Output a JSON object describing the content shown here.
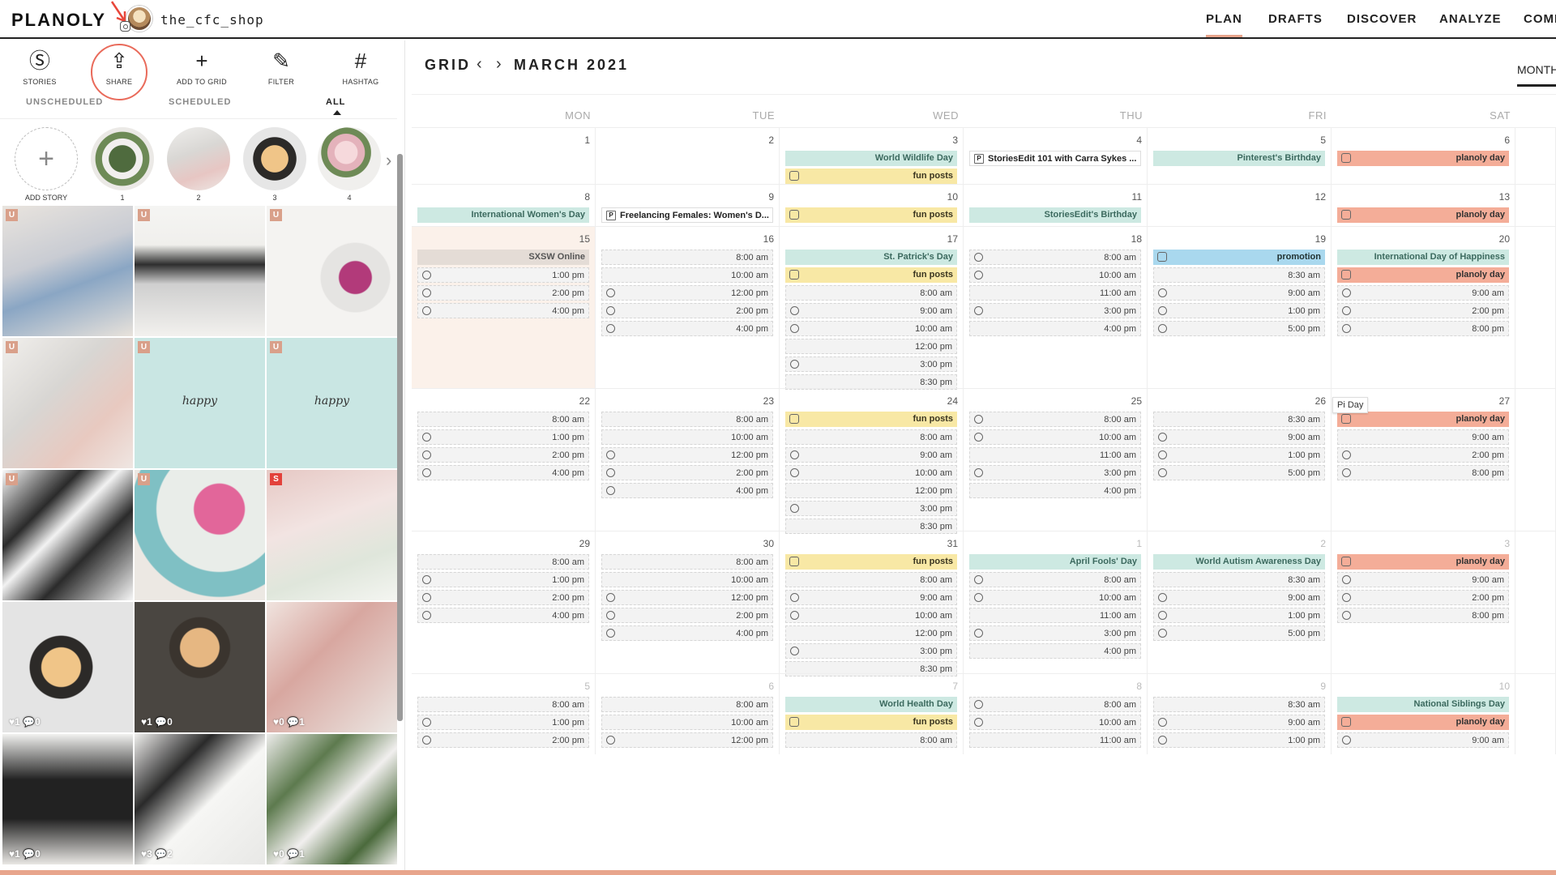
{
  "header": {
    "logo": "PLANOLY",
    "account": "the_cfc_shop",
    "nav": [
      "PLAN",
      "DRAFTS",
      "DISCOVER",
      "ANALYZE",
      "COMI"
    ]
  },
  "toolbar": [
    {
      "icon": "stories-icon",
      "glyph": "Ⓢ",
      "label": "STORIES"
    },
    {
      "icon": "share-icon",
      "glyph": "⇪",
      "label": "SHARE"
    },
    {
      "icon": "plus-icon",
      "glyph": "+",
      "label": "ADD TO GRID"
    },
    {
      "icon": "magic-wand-icon",
      "glyph": "✎",
      "label": "FILTER"
    },
    {
      "icon": "hashtag-icon",
      "glyph": "#",
      "label": "HASHTAG"
    }
  ],
  "left_tabs": [
    "UNSCHEDULED",
    "SCHEDULED",
    "ALL"
  ],
  "stories": {
    "add_label": "ADD STORY",
    "add_glyph": "+",
    "next_glyph": "›",
    "items": [
      "1",
      "2",
      "3",
      "4"
    ]
  },
  "grid_tiles": [
    {
      "badge": "U",
      "bg": "linear-gradient(160deg,#e9e4de 0%,#c9ccd3 40%,#8aa6c4 60%,#e8e2db 100%)"
    },
    {
      "badge": "U",
      "bg": "linear-gradient(180deg,#f5f5f3 0%,#f0efec 30%,#2e2e2e 45%,#cfcfcf 60%,#f2f1ee 100%)"
    },
    {
      "badge": "U",
      "bg": "radial-gradient(circle at 68% 55%,#b23a7a 0 14%,#e5e4e2 15% 30%,#f4f3f1 31%)"
    },
    {
      "badge": "U",
      "bg": "linear-gradient(135deg,#f1efec 0%,#d8d6d3 40%,#e8c9c0 70%,#efe6e2 100%)"
    },
    {
      "badge": "U",
      "bg": "#c9e6e3",
      "text": "happy"
    },
    {
      "badge": "U",
      "bg": "#c9e6e3",
      "text": "happy"
    },
    {
      "badge": "U",
      "bg": "linear-gradient(135deg,#fafafa 0%,#2a2a2a 30%,#f2f2f2 45%,#2b2b2b 65%,#f6f6f6 100%)"
    },
    {
      "badge": "U",
      "bg": "radial-gradient(circle at 65% 30%,#e2669a 0 20%,#e9ede9 21% 50%,#7fc0c4 51% 70%,#ece8e3 71%)"
    },
    {
      "badge": "S",
      "bg": "linear-gradient(160deg,#e6c8c4 0%,#f2e4e2 40%,#dfe6db 70%,#f4f5f1 100%)"
    },
    {
      "badge": "",
      "bg": "radial-gradient(circle at 45% 50%,#f0c588 0 20%,#2c2a28 21% 32%,#e4e4e4 33%)",
      "stats": "♥1 💬0"
    },
    {
      "badge": "",
      "bg": "radial-gradient(circle at 50% 35%,#e6b782 0 18%,#3a342e 19% 28%,#4a4641 29%)",
      "stats": "♥1 💬0"
    },
    {
      "badge": "",
      "bg": "linear-gradient(135deg,#f0e4df 0%,#d8a7a0 40%,#ebe6e2 100%)",
      "stats": "♥0 💬1"
    },
    {
      "badge": "",
      "bg": "linear-gradient(180deg,#f1f1ef 0%,#222 35%,#222 65%,#e9e7e4 100%)",
      "stats": "♥1 💬0"
    },
    {
      "badge": "",
      "bg": "linear-gradient(135deg,#efeeec 0%,#2a2a2a 30%,#f6f6f4 55%,#e8e8e6 100%)",
      "stats": "♥3 💬2"
    },
    {
      "badge": "",
      "bg": "linear-gradient(135deg,#edeceb 0%,#5d7a4e 30%,#f1efee 55%,#4b6a3c 80%,#f0efed 100%)",
      "stats": "♥0 💬1"
    }
  ],
  "calendar": {
    "view": "GRID",
    "prev_glyph": "‹",
    "next_glyph": "›",
    "month": "MARCH 2021",
    "view_mode": "MONTH",
    "days_of_week": [
      "MON",
      "TUE",
      "WED",
      "THU",
      "FRI",
      "SAT"
    ],
    "tooltip": "Pi Day",
    "weeks": [
      {
        "height": 70,
        "days": [
          {
            "num": "1",
            "events": []
          },
          {
            "num": "2",
            "events": []
          },
          {
            "num": "3",
            "events": [
              {
                "type": "holiday",
                "label": "World Wildlife Day"
              },
              {
                "type": "fun",
                "label": "fun posts"
              }
            ]
          },
          {
            "num": "4",
            "events": [
              {
                "type": "story-ev",
                "label": "StoriesEdit 101 with Carra Sykes ..."
              }
            ]
          },
          {
            "num": "5",
            "events": [
              {
                "type": "holiday",
                "label": "Pinterest's Birthday"
              }
            ]
          },
          {
            "num": "6",
            "events": [
              {
                "type": "planoly",
                "label": "planoly day"
              }
            ]
          }
        ]
      },
      {
        "height": 52,
        "days": [
          {
            "num": "8",
            "events": [
              {
                "type": "holiday",
                "label": "International Women's Day"
              }
            ]
          },
          {
            "num": "9",
            "events": [
              {
                "type": "story-ev",
                "label": "Freelancing Females: Women's D..."
              }
            ]
          },
          {
            "num": "10",
            "events": [
              {
                "type": "fun",
                "label": "fun posts"
              }
            ]
          },
          {
            "num": "11",
            "events": [
              {
                "type": "holiday",
                "label": "StoriesEdit's Birthday"
              }
            ]
          },
          {
            "num": "12",
            "events": []
          },
          {
            "num": "13",
            "events": [
              {
                "type": "planoly",
                "label": "planoly day"
              }
            ]
          }
        ]
      },
      {
        "height": 200,
        "days": [
          {
            "num": "15",
            "shade": true,
            "events": [
              {
                "type": "holiday-gray",
                "label": "SXSW Online"
              },
              {
                "type": "post",
                "label": "1:00 pm"
              },
              {
                "type": "post",
                "label": "2:00 pm"
              },
              {
                "type": "post",
                "label": "4:00 pm"
              }
            ]
          },
          {
            "num": "16",
            "events": [
              {
                "type": "post-noicon",
                "label": "8:00 am"
              },
              {
                "type": "post-noicon",
                "label": "10:00 am"
              },
              {
                "type": "post",
                "label": "12:00 pm"
              },
              {
                "type": "post",
                "label": "2:00 pm"
              },
              {
                "type": "post",
                "label": "4:00 pm"
              }
            ]
          },
          {
            "num": "17",
            "events": [
              {
                "type": "holiday",
                "label": "St. Patrick's Day"
              },
              {
                "type": "fun",
                "label": "fun posts"
              },
              {
                "type": "post-noicon",
                "label": "8:00 am"
              },
              {
                "type": "post",
                "label": "9:00 am"
              },
              {
                "type": "post",
                "label": "10:00 am"
              },
              {
                "type": "post-noicon",
                "label": "12:00 pm"
              },
              {
                "type": "post",
                "label": "3:00 pm"
              },
              {
                "type": "post-noicon",
                "label": "8:30 pm"
              }
            ]
          },
          {
            "num": "18",
            "events": [
              {
                "type": "post",
                "label": "8:00 am"
              },
              {
                "type": "post",
                "label": "10:00 am"
              },
              {
                "type": "post-noicon",
                "label": "11:00 am"
              },
              {
                "type": "post",
                "label": "3:00 pm"
              },
              {
                "type": "post-noicon",
                "label": "4:00 pm"
              }
            ]
          },
          {
            "num": "19",
            "events": [
              {
                "type": "promo",
                "label": "promotion"
              },
              {
                "type": "post-noicon",
                "label": "8:30 am"
              },
              {
                "type": "post",
                "label": "9:00 am"
              },
              {
                "type": "post",
                "label": "1:00 pm"
              },
              {
                "type": "post",
                "label": "5:00 pm"
              }
            ]
          },
          {
            "num": "20",
            "events": [
              {
                "type": "holiday",
                "label": "International Day of Happiness"
              },
              {
                "type": "planoly",
                "label": "planoly day"
              },
              {
                "type": "post",
                "label": "9:00 am"
              },
              {
                "type": "post",
                "label": "2:00 pm"
              },
              {
                "type": "post",
                "label": "8:00 pm"
              }
            ]
          }
        ]
      },
      {
        "height": 176,
        "days": [
          {
            "num": "22",
            "events": [
              {
                "type": "post-noicon",
                "label": "8:00 am"
              },
              {
                "type": "post",
                "label": "1:00 pm"
              },
              {
                "type": "post",
                "label": "2:00 pm"
              },
              {
                "type": "post",
                "label": "4:00 pm"
              }
            ]
          },
          {
            "num": "23",
            "events": [
              {
                "type": "post-noicon",
                "label": "8:00 am"
              },
              {
                "type": "post-noicon",
                "label": "10:00 am"
              },
              {
                "type": "post",
                "label": "12:00 pm"
              },
              {
                "type": "post",
                "label": "2:00 pm"
              },
              {
                "type": "post",
                "label": "4:00 pm"
              }
            ]
          },
          {
            "num": "24",
            "events": [
              {
                "type": "fun",
                "label": "fun posts"
              },
              {
                "type": "post-noicon",
                "label": "8:00 am"
              },
              {
                "type": "post",
                "label": "9:00 am"
              },
              {
                "type": "post",
                "label": "10:00 am"
              },
              {
                "type": "post-noicon",
                "label": "12:00 pm"
              },
              {
                "type": "post",
                "label": "3:00 pm"
              },
              {
                "type": "post-noicon",
                "label": "8:30 pm"
              }
            ]
          },
          {
            "num": "25",
            "events": [
              {
                "type": "post",
                "label": "8:00 am"
              },
              {
                "type": "post",
                "label": "10:00 am"
              },
              {
                "type": "post-noicon",
                "label": "11:00 am"
              },
              {
                "type": "post",
                "label": "3:00 pm"
              },
              {
                "type": "post-noicon",
                "label": "4:00 pm"
              }
            ]
          },
          {
            "num": "26",
            "events": [
              {
                "type": "post-noicon",
                "label": "8:30 am"
              },
              {
                "type": "post",
                "label": "9:00 am"
              },
              {
                "type": "post",
                "label": "1:00 pm"
              },
              {
                "type": "post",
                "label": "5:00 pm"
              }
            ]
          },
          {
            "num": "27",
            "events": [
              {
                "type": "planoly",
                "label": "planoly day"
              },
              {
                "type": "post-noicon",
                "label": "9:00 am"
              },
              {
                "type": "post",
                "label": "2:00 pm"
              },
              {
                "type": "post",
                "label": "8:00 pm"
              }
            ]
          }
        ]
      },
      {
        "height": 176,
        "days": [
          {
            "num": "29",
            "events": [
              {
                "type": "post-noicon",
                "label": "8:00 am"
              },
              {
                "type": "post",
                "label": "1:00 pm"
              },
              {
                "type": "post",
                "label": "2:00 pm"
              },
              {
                "type": "post",
                "label": "4:00 pm"
              }
            ]
          },
          {
            "num": "30",
            "events": [
              {
                "type": "post-noicon",
                "label": "8:00 am"
              },
              {
                "type": "post-noicon",
                "label": "10:00 am"
              },
              {
                "type": "post",
                "label": "12:00 pm"
              },
              {
                "type": "post",
                "label": "2:00 pm"
              },
              {
                "type": "post",
                "label": "4:00 pm"
              }
            ]
          },
          {
            "num": "31",
            "events": [
              {
                "type": "fun",
                "label": "fun posts"
              },
              {
                "type": "post-noicon",
                "label": "8:00 am"
              },
              {
                "type": "post",
                "label": "9:00 am"
              },
              {
                "type": "post",
                "label": "10:00 am"
              },
              {
                "type": "post-noicon",
                "label": "12:00 pm"
              },
              {
                "type": "post",
                "label": "3:00 pm"
              },
              {
                "type": "post-noicon",
                "label": "8:30 pm"
              }
            ]
          },
          {
            "num": "1",
            "other": true,
            "events": [
              {
                "type": "holiday",
                "label": "April Fools' Day"
              },
              {
                "type": "post",
                "label": "8:00 am"
              },
              {
                "type": "post",
                "label": "10:00 am"
              },
              {
                "type": "post-noicon",
                "label": "11:00 am"
              },
              {
                "type": "post",
                "label": "3:00 pm"
              },
              {
                "type": "post-noicon",
                "label": "4:00 pm"
              }
            ]
          },
          {
            "num": "2",
            "other": true,
            "events": [
              {
                "type": "holiday",
                "label": "World Autism Awareness Day"
              },
              {
                "type": "post-noicon",
                "label": "8:30 am"
              },
              {
                "type": "post",
                "label": "9:00 am"
              },
              {
                "type": "post",
                "label": "1:00 pm"
              },
              {
                "type": "post",
                "label": "5:00 pm"
              }
            ]
          },
          {
            "num": "3",
            "other": true,
            "events": [
              {
                "type": "planoly",
                "label": "planoly day"
              },
              {
                "type": "post",
                "label": "9:00 am"
              },
              {
                "type": "post",
                "label": "2:00 pm"
              },
              {
                "type": "post",
                "label": "8:00 pm"
              }
            ]
          }
        ]
      },
      {
        "height": 100,
        "days": [
          {
            "num": "5",
            "other": true,
            "events": [
              {
                "type": "post-noicon",
                "label": "8:00 am"
              },
              {
                "type": "post",
                "label": "1:00 pm"
              },
              {
                "type": "post",
                "label": "2:00 pm"
              }
            ]
          },
          {
            "num": "6",
            "other": true,
            "events": [
              {
                "type": "post-noicon",
                "label": "8:00 am"
              },
              {
                "type": "post-noicon",
                "label": "10:00 am"
              },
              {
                "type": "post",
                "label": "12:00 pm"
              }
            ]
          },
          {
            "num": "7",
            "other": true,
            "events": [
              {
                "type": "holiday",
                "label": "World Health Day"
              },
              {
                "type": "fun",
                "label": "fun posts"
              },
              {
                "type": "post-noicon",
                "label": "8:00 am"
              }
            ]
          },
          {
            "num": "8",
            "other": true,
            "events": [
              {
                "type": "post",
                "label": "8:00 am"
              },
              {
                "type": "post",
                "label": "10:00 am"
              },
              {
                "type": "post-noicon",
                "label": "11:00 am"
              }
            ]
          },
          {
            "num": "9",
            "other": true,
            "events": [
              {
                "type": "post-noicon",
                "label": "8:30 am"
              },
              {
                "type": "post",
                "label": "9:00 am"
              },
              {
                "type": "post",
                "label": "1:00 pm"
              }
            ]
          },
          {
            "num": "10",
            "other": true,
            "events": [
              {
                "type": "holiday",
                "label": "National Siblings Day"
              },
              {
                "type": "planoly",
                "label": "planoly day"
              },
              {
                "type": "post",
                "label": "9:00 am"
              }
            ]
          }
        ]
      }
    ]
  }
}
